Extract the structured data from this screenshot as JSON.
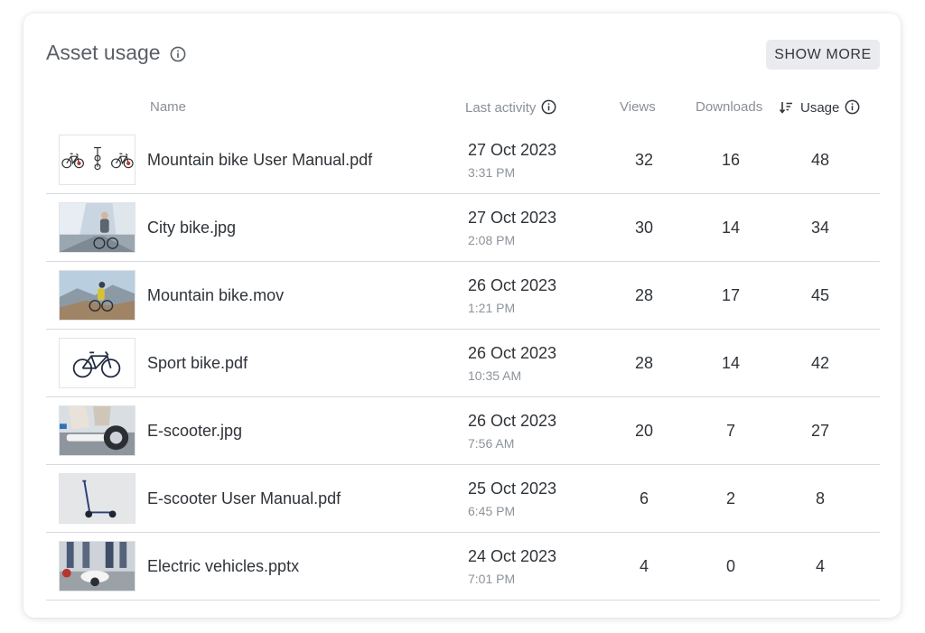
{
  "card": {
    "title": "Asset usage",
    "show_more_label": "SHOW MORE"
  },
  "columns": {
    "name": "Name",
    "last_activity": "Last activity",
    "views": "Views",
    "downloads": "Downloads",
    "usage": "Usage",
    "sorted_by": "usage"
  },
  "rows": [
    {
      "name": "Mountain bike User Manual.pdf",
      "date": "27 Oct 2023",
      "time": "3:31 PM",
      "views": "32",
      "downloads": "16",
      "usage": "48",
      "thumb": "bike-manual-thumbnail"
    },
    {
      "name": "City bike.jpg",
      "date": "27 Oct 2023",
      "time": "2:08 PM",
      "views": "30",
      "downloads": "14",
      "usage": "34",
      "thumb": "city-bike-photo"
    },
    {
      "name": "Mountain bike.mov",
      "date": "26 Oct 2023",
      "time": "1:21 PM",
      "views": "28",
      "downloads": "17",
      "usage": "45",
      "thumb": "mountain-bike-photo"
    },
    {
      "name": "Sport bike.pdf",
      "date": "26 Oct 2023",
      "time": "10:35 AM",
      "views": "28",
      "downloads": "14",
      "usage": "42",
      "thumb": "sport-bike-thumbnail"
    },
    {
      "name": "E-scooter.jpg",
      "date": "26 Oct 2023",
      "time": "7:56 AM",
      "views": "20",
      "downloads": "7",
      "usage": "27",
      "thumb": "e-scooter-photo"
    },
    {
      "name": "E-scooter User Manual.pdf",
      "date": "25 Oct 2023",
      "time": "6:45 PM",
      "views": "6",
      "downloads": "2",
      "usage": "8",
      "thumb": "e-scooter-manual-thumbnail"
    },
    {
      "name": "Electric vehicles.pptx",
      "date": "24 Oct 2023",
      "time": "7:01 PM",
      "views": "4",
      "downloads": "0",
      "usage": "4",
      "thumb": "electric-vehicles-photo"
    }
  ],
  "colors": {
    "text": "#2f3338",
    "muted": "#8a8f96",
    "divider": "#d6d9dd",
    "button_bg": "#e9ebee"
  }
}
